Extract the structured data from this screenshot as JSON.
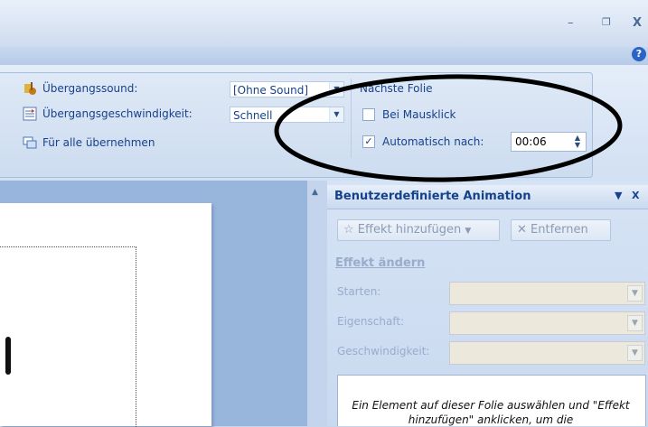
{
  "window": {
    "minimize_glyph": "–",
    "restore_glyph": "❐",
    "close_glyph": "X",
    "help_glyph": "?"
  },
  "transition": {
    "sound_label": "Übergangssound:",
    "sound_value": "[Ohne Sound]",
    "speed_label": "Übergangsgeschwindigkeit:",
    "speed_value": "Schnell",
    "apply_all_label": "Für alle übernehmen"
  },
  "next_slide": {
    "heading": "Nächste Folie",
    "on_click_label": "Bei Mausklick",
    "on_click_checked": false,
    "auto_label": "Automatisch nach:",
    "auto_checked": true,
    "auto_time": "00:06"
  },
  "pane": {
    "title": "Benutzerdefinierte Animation",
    "add_effect": "Effekt hinzufügen",
    "remove": "Entfernen",
    "section": "Effekt ändern",
    "start_label": "Starten:",
    "property_label": "Eigenschaft:",
    "speed_label": "Geschwindigkeit:",
    "hint": "Ein Element auf dieser Folie auswählen und \"Effekt hinzufügen\" anklicken, um die"
  },
  "colors": {
    "ribbon_text": "#15428b",
    "disabled_text": "#9aaccb",
    "annotation": "#000000"
  }
}
